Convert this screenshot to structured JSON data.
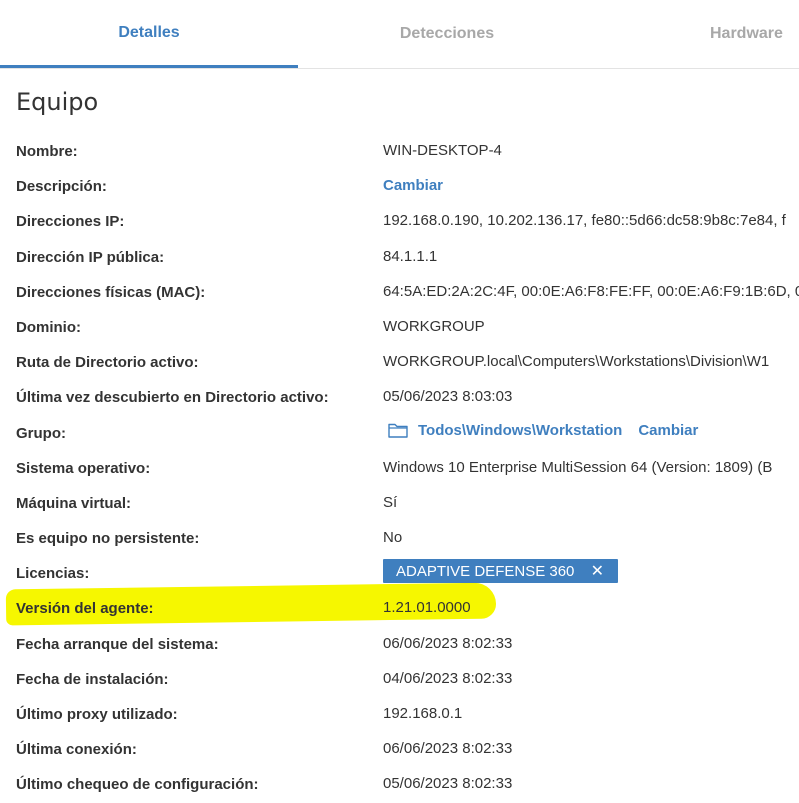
{
  "tabs": [
    {
      "label": "Detalles",
      "active": true
    },
    {
      "label": "Detecciones",
      "active": false
    },
    {
      "label": "Hardware",
      "active": false
    }
  ],
  "section": {
    "title": "Equipo"
  },
  "rows": {
    "nombre": {
      "label": "Nombre:",
      "value": "WIN-DESKTOP-4"
    },
    "descripcion": {
      "label": "Descripción:",
      "link": "Cambiar"
    },
    "ips": {
      "label": "Direcciones IP:",
      "value": "192.168.0.190, 10.202.136.17, fe80::5d66:dc58:9b8c:7e84, f"
    },
    "ip_publica": {
      "label": "Dirección IP pública:",
      "value": "84.1.1.1"
    },
    "mac": {
      "label": "Direcciones físicas (MAC):",
      "value": "64:5A:ED:2A:2C:4F, 00:0E:A6:F8:FE:FF, 00:0E:A6:F9:1B:6D, 0"
    },
    "dominio": {
      "label": "Dominio:",
      "value": "WORKGROUP"
    },
    "ruta_ad": {
      "label": "Ruta de Directorio activo:",
      "value": "WORKGROUP.local\\Computers\\Workstations\\Division\\W1"
    },
    "ultima_vez_ad": {
      "label": "Última vez descubierto en Directorio activo:",
      "value": "05/06/2023 8:03:03"
    },
    "grupo": {
      "label": "Grupo:",
      "path": "Todos\\Windows\\Workstation",
      "link": "Cambiar",
      "icon": "folder-icon"
    },
    "so": {
      "label": "Sistema operativo:",
      "value": "Windows 10 Enterprise MultiSession 64 (Version: 1809) (B"
    },
    "maquina_virtual": {
      "label": "Máquina virtual:",
      "value": "Sí"
    },
    "no_persistente": {
      "label": "Es equipo no persistente:",
      "value": "No"
    },
    "licencias": {
      "label": "Licencias:",
      "chip": "ADAPTIVE DEFENSE 360",
      "chip_close": "✕"
    },
    "version_agente": {
      "label": "Versión del agente:",
      "value": "1.21.01.0000"
    },
    "fecha_arranque": {
      "label": "Fecha arranque del sistema:",
      "value": "06/06/2023 8:02:33"
    },
    "fecha_instalacion": {
      "label": "Fecha de instalación:",
      "value": "04/06/2023 8:02:33"
    },
    "ultimo_proxy": {
      "label": "Último proxy utilizado:",
      "value": "192.168.0.1"
    },
    "ultima_conexion": {
      "label": "Última conexión:",
      "value": "06/06/2023 8:02:33"
    },
    "ultimo_chequeo": {
      "label": "Último chequeo de configuración:",
      "value": "05/06/2023 8:02:33"
    }
  },
  "colors": {
    "accent": "#3f7fbf",
    "highlight": "#f6f700",
    "tab_inactive": "#a8a8a8"
  }
}
